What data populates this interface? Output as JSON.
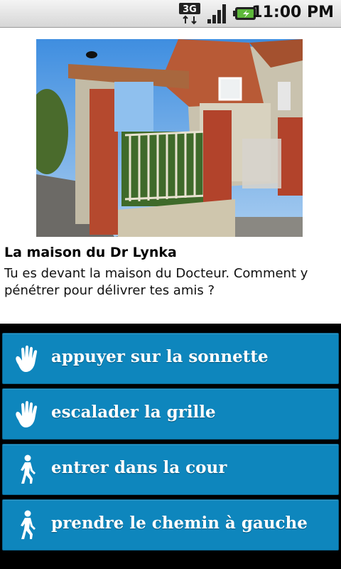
{
  "status_bar": {
    "time": "11:00 PM",
    "network_type": "3G",
    "icons": [
      "network-3g-icon",
      "signal-strength-icon",
      "battery-charging-icon"
    ]
  },
  "scene": {
    "image": "house-with-gate-photo",
    "title": "La maison du Dr Lynka",
    "description": "Tu es devant la maison du Docteur. Comment y pénétrer pour délivrer tes amis ?"
  },
  "choices": [
    {
      "label": "appuyer sur la sonnette",
      "icon": "hand-icon"
    },
    {
      "label": "escalader la grille",
      "icon": "hand-icon"
    },
    {
      "label": "entrer dans la cour",
      "icon": "walking-person-icon"
    },
    {
      "label": "prendre le chemin à gauche",
      "icon": "walking-person-icon"
    }
  ],
  "colors": {
    "choice_background": "#0e86bd",
    "page_background": "#ffffff",
    "screen_background": "#000000"
  }
}
